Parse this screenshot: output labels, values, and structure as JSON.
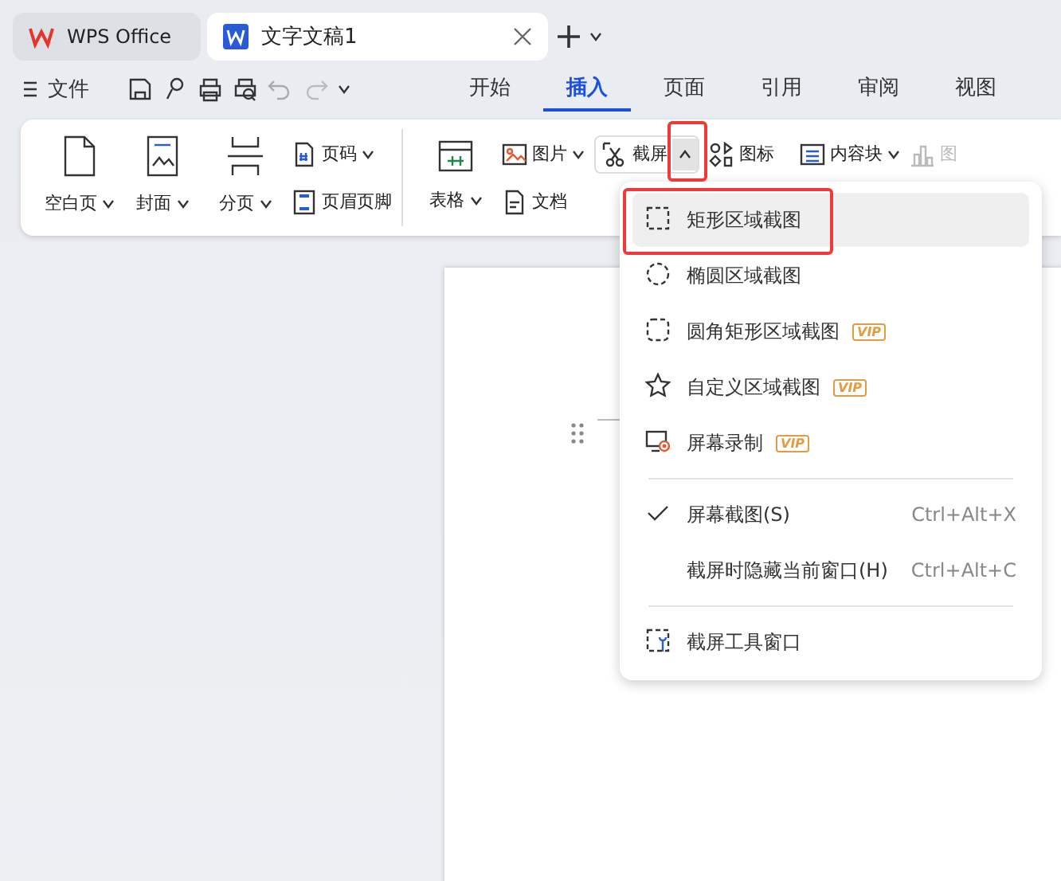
{
  "tabs": [
    {
      "label": "WPS Office",
      "kind": "home",
      "selected": false
    },
    {
      "label": "文字文稿1",
      "kind": "doc",
      "selected": true
    }
  ],
  "toolbar": {
    "file_label": "文件",
    "ribbon_tabs": [
      {
        "label": "开始",
        "selected": false
      },
      {
        "label": "插入",
        "selected": true
      },
      {
        "label": "页面",
        "selected": false
      },
      {
        "label": "引用",
        "selected": false
      },
      {
        "label": "审阅",
        "selected": false
      },
      {
        "label": "视图",
        "selected": false
      }
    ]
  },
  "ribbon": {
    "page_group": {
      "large": [
        {
          "label": "空白页",
          "kind": "blank"
        },
        {
          "label": "封面",
          "kind": "cover"
        },
        {
          "label": "分页",
          "kind": "break"
        }
      ],
      "small": [
        {
          "label": "页码",
          "dropdown": true,
          "kind": "pagenum"
        },
        {
          "label": "页眉页脚",
          "dropdown": false,
          "kind": "header"
        }
      ]
    },
    "insert_group": {
      "table_label": "表格",
      "picture_label": "图片",
      "doc_label": "文档",
      "screenshot_label": "截屏",
      "screenshot_open": true,
      "icon_label": "图标",
      "content_label": "内容块",
      "chart_label": "图",
      "chart_disabled": true
    }
  },
  "menu": [
    {
      "kind": "rect",
      "label": "矩形区域截图",
      "selected": true,
      "checked": false
    },
    {
      "kind": "ellipse",
      "label": "椭圆区域截图",
      "selected": false,
      "checked": false
    },
    {
      "kind": "round",
      "label": "圆角矩形区域截图",
      "selected": false,
      "checked": false,
      "badge": "VIP"
    },
    {
      "kind": "star",
      "label": "自定义区域截图",
      "selected": false,
      "checked": false,
      "badge": "VIP"
    },
    {
      "kind": "record",
      "label": "屏幕录制",
      "selected": false,
      "checked": false,
      "badge": "VIP"
    },
    {
      "kind": "divider"
    },
    {
      "kind": "plain",
      "label": "屏幕截图(S)",
      "shortcut": "Ctrl+Alt+X",
      "selected": false,
      "checked": true
    },
    {
      "kind": "plain",
      "label": "截屏时隐藏当前窗口(H)",
      "shortcut": "Ctrl+Alt+C",
      "selected": false,
      "checked": false
    },
    {
      "kind": "divider"
    },
    {
      "kind": "tool",
      "label": "截屏工具窗口",
      "selected": false,
      "checked": false
    }
  ]
}
